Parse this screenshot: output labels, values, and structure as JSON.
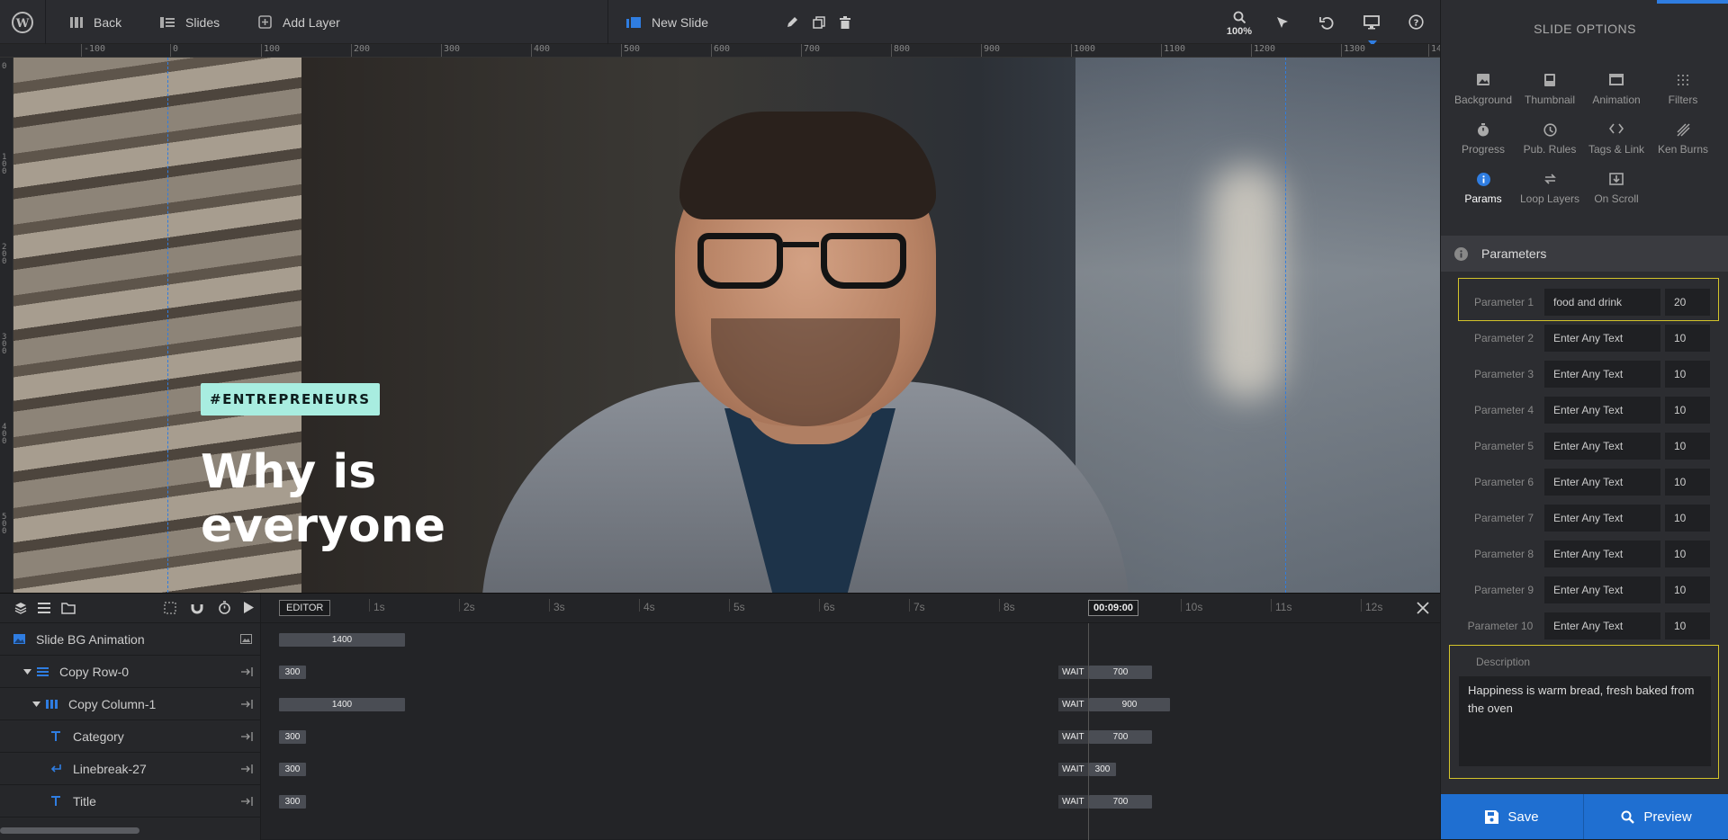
{
  "topbar": {
    "back_label": "Back",
    "slides_label": "Slides",
    "add_layer_label": "Add Layer",
    "slide_name": "New Slide",
    "zoom_label": "100%"
  },
  "ruler": {
    "top_ticks": [
      "-100",
      "0",
      "100",
      "200",
      "300",
      "400",
      "500",
      "600",
      "700",
      "800",
      "900",
      "1000",
      "1100",
      "1200",
      "1300",
      "14"
    ],
    "left_ticks": [
      "0",
      "100",
      "200",
      "300",
      "400",
      "500"
    ]
  },
  "canvas": {
    "tag_text": "#ENTREPRENEURS",
    "headline_line1": "Why is",
    "headline_line2": "everyone"
  },
  "timeline": {
    "editor_label": "EDITOR",
    "time_ticks": [
      "1s",
      "2s",
      "3s",
      "4s",
      "5s",
      "6s",
      "7s",
      "8s",
      "9s",
      "10s",
      "11s",
      "12s"
    ],
    "current_time": "00:09:00",
    "layers": [
      {
        "name": "Slide BG Animation",
        "bar": "1400",
        "wait": "",
        "end": ""
      },
      {
        "name": "Copy Row-0",
        "bar": "300",
        "wait": "WAIT",
        "end": "700"
      },
      {
        "name": "Copy Column-1",
        "bar": "1400",
        "wait": "WAIT",
        "end": "900"
      },
      {
        "name": "Category",
        "bar": "300",
        "wait": "WAIT",
        "end": "700"
      },
      {
        "name": "Linebreak-27",
        "bar": "300",
        "wait": "WAIT",
        "end": "300"
      },
      {
        "name": "Title",
        "bar": "300",
        "wait": "WAIT",
        "end": "700"
      }
    ]
  },
  "panel": {
    "title": "SLIDE OPTIONS",
    "options": [
      {
        "label": "Background",
        "icon": "image-icon"
      },
      {
        "label": "Thumbnail",
        "icon": "thumbnail-icon"
      },
      {
        "label": "Animation",
        "icon": "film-icon"
      },
      {
        "label": "Filters",
        "icon": "filters-icon"
      },
      {
        "label": "Progress",
        "icon": "stopwatch-icon"
      },
      {
        "label": "Pub. Rules",
        "icon": "clock-icon"
      },
      {
        "label": "Tags & Link",
        "icon": "code-icon"
      },
      {
        "label": "Ken Burns",
        "icon": "ken-burns-icon"
      },
      {
        "label": "Params",
        "icon": "info-icon"
      },
      {
        "label": "Loop Layers",
        "icon": "loop-icon"
      },
      {
        "label": "On Scroll",
        "icon": "scroll-icon"
      }
    ],
    "section_title": "Parameters",
    "params": [
      {
        "label": "Parameter 1",
        "value": "food and drink",
        "placeholder": "Enter Any Text",
        "num": "20"
      },
      {
        "label": "Parameter 2",
        "value": "",
        "placeholder": "Enter Any Text",
        "num": "10"
      },
      {
        "label": "Parameter 3",
        "value": "",
        "placeholder": "Enter Any Text",
        "num": "10"
      },
      {
        "label": "Parameter 4",
        "value": "",
        "placeholder": "Enter Any Text",
        "num": "10"
      },
      {
        "label": "Parameter 5",
        "value": "",
        "placeholder": "Enter Any Text",
        "num": "10"
      },
      {
        "label": "Parameter 6",
        "value": "",
        "placeholder": "Enter Any Text",
        "num": "10"
      },
      {
        "label": "Parameter 7",
        "value": "",
        "placeholder": "Enter Any Text",
        "num": "10"
      },
      {
        "label": "Parameter 8",
        "value": "",
        "placeholder": "Enter Any Text",
        "num": "10"
      },
      {
        "label": "Parameter 9",
        "value": "",
        "placeholder": "Enter Any Text",
        "num": "10"
      },
      {
        "label": "Parameter 10",
        "value": "",
        "placeholder": "Enter Any Text",
        "num": "10"
      }
    ],
    "description_label": "Description",
    "description_value": "Happiness is warm bread, fresh baked from the oven",
    "save_label": "Save",
    "preview_label": "Preview"
  },
  "colors": {
    "accent": "#2f7de1",
    "highlight": "#d4c42a",
    "tag_bg": "#a8ede0"
  }
}
